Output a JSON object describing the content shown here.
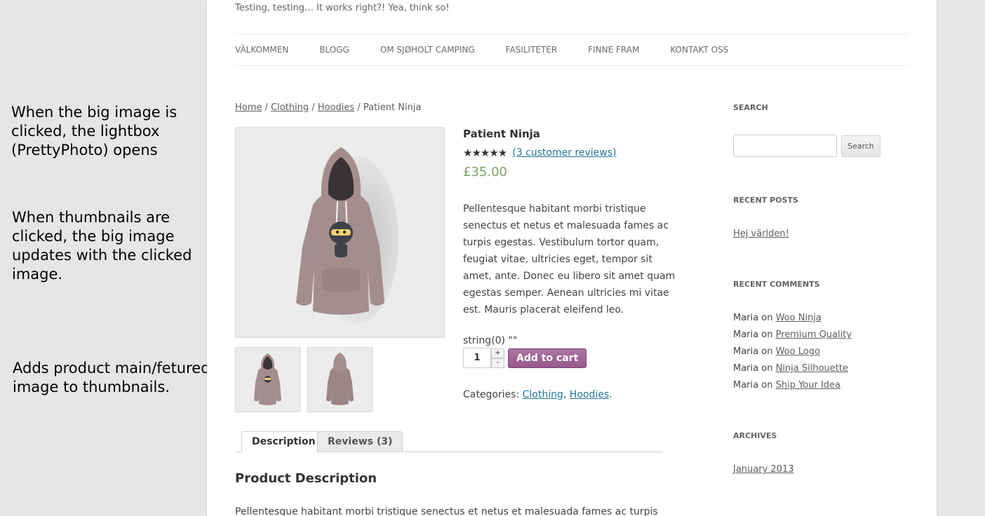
{
  "annotations": {
    "lightbox": "When the big image is clicked, the lightbox (PrettyPhoto) opens",
    "thumbnails": "When thumbnails are clicked, the big image updates with the clicked image.",
    "featured": "Adds product main/fetured image to thumbnails."
  },
  "site": {
    "tagline": "Testing, testing… It works right?! Yea, think so!"
  },
  "nav": {
    "items": [
      "VÄLKOMMEN",
      "BLOGG",
      "OM SJØHOLT CAMPING",
      "FASILITETER",
      "FINNE FRAM",
      "KONTAKT OSS"
    ]
  },
  "breadcrumb": {
    "home": "Home",
    "sep": "/",
    "clothing": "Clothing",
    "hoodies": "Hoodies",
    "current": "Patient Ninja"
  },
  "product": {
    "title": "Patient Ninja",
    "stars": "★★★★★",
    "rating": 4.67,
    "reviews_link": "(3 customer reviews)",
    "price": "£35.00",
    "description": "Pellentesque habitant morbi tristique senectus et netus et malesuada fames ac turpis egestas. Vestibulum tortor quam, feugiat vitae, ultricies eget, tempor sit amet, ante. Donec eu libero sit amet quam egestas semper. Aenean ultricies mi vitae est. Mauris placerat eleifend leo.",
    "debug": "string(0) \"\"",
    "quantity": "1",
    "qty_plus": "+",
    "qty_minus": "-",
    "add_to_cart": "Add to cart",
    "categories_label": "Categories:",
    "category1": "Clothing",
    "category2": "Hoodies",
    "hoodie_color": "#a48d8e"
  },
  "tabs": {
    "description": "Description",
    "reviews": "Reviews (3)"
  },
  "product_description": {
    "heading": "Product Description",
    "text": "Pellentesque habitant morbi tristique senectus et netus et malesuada fames ac turpis"
  },
  "sidebar": {
    "search_title": "SEARCH",
    "search_button": "Search",
    "recent_posts_title": "RECENT POSTS",
    "recent_post": "Hej världen!",
    "recent_comments_title": "RECENT COMMENTS",
    "comments": [
      {
        "author": "Maria",
        "on": "on",
        "post": "Woo Ninja"
      },
      {
        "author": "Maria",
        "on": "on",
        "post": "Premium Quality"
      },
      {
        "author": "Maria",
        "on": "on",
        "post": "Woo Logo"
      },
      {
        "author": "Maria",
        "on": "on",
        "post": "Ninja Silhouette"
      },
      {
        "author": "Maria",
        "on": "on",
        "post": "Ship Your Idea"
      }
    ],
    "archives_title": "ARCHIVES",
    "archive": "January 2013"
  },
  "colors": {
    "price": "#77a464",
    "button": "#96588a",
    "link": "#21759b"
  }
}
